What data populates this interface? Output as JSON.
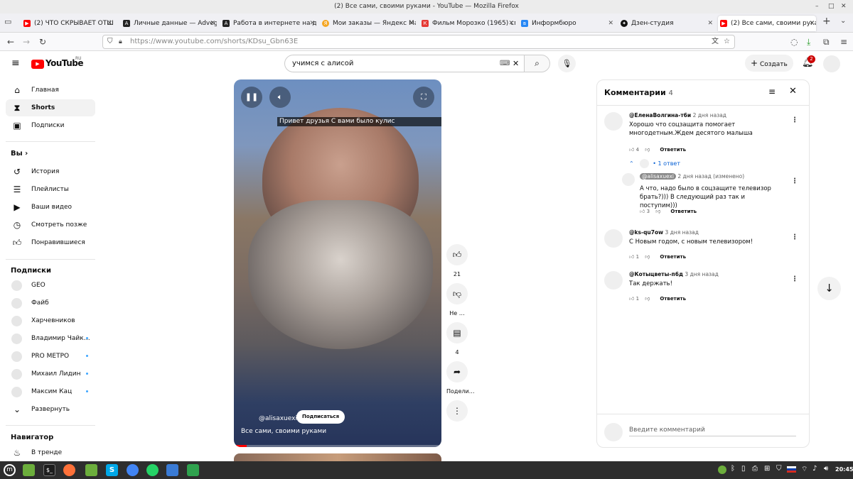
{
  "window": {
    "title": "(2) Все сами, своими руками - YouTube — Mozilla Firefox"
  },
  "tabs": [
    {
      "label": "(2) ЧТО СКРЫВАЕТ ОТШЕЛ",
      "fav": "yt"
    },
    {
      "label": "Личные данные — Advego",
      "fav": "A"
    },
    {
      "label": "Работа в интернете на до",
      "fav": "A"
    },
    {
      "label": "Мои заказы — Яндекс Ма",
      "fav": "Я"
    },
    {
      "label": "Фильм Морозко (1965) см",
      "fav": "К"
    },
    {
      "label": "Информбюро",
      "fav": "VK"
    },
    {
      "label": "Дзен-студия",
      "fav": "Д"
    },
    {
      "label": "(2) Все сами, своими рука",
      "fav": "yt"
    }
  ],
  "url": "https://www.youtube.com/shorts/KDsu_Gbn63E",
  "yt": {
    "logo": "YouTube",
    "region": "RU",
    "search_value": "учимся с алисой",
    "create_label": "Создать",
    "notif_count": "2"
  },
  "sidebar": {
    "main": [
      {
        "label": "Главная",
        "icon": "home-icon"
      },
      {
        "label": "Shorts",
        "icon": "shorts-icon"
      },
      {
        "label": "Подписки",
        "icon": "subscriptions-icon"
      }
    ],
    "you_header": "Вы",
    "you": [
      {
        "label": "История",
        "icon": "history-icon"
      },
      {
        "label": "Плейлисты",
        "icon": "playlists-icon"
      },
      {
        "label": "Ваши видео",
        "icon": "your-videos-icon"
      },
      {
        "label": "Смотреть позже",
        "icon": "watch-later-icon"
      },
      {
        "label": "Понравившиеся",
        "icon": "liked-icon"
      }
    ],
    "subs_header": "Подписки",
    "subs": [
      {
        "label": "GEO",
        "dot": false
      },
      {
        "label": "Файб",
        "dot": false
      },
      {
        "label": "Харчевников",
        "dot": false
      },
      {
        "label": "Владимир Чайк…",
        "dot": true
      },
      {
        "label": "PRO МЕТРО",
        "dot": true
      },
      {
        "label": "Михаил Лидин",
        "dot": true
      },
      {
        "label": "Максим Кац",
        "dot": true
      }
    ],
    "expand": "Развернуть",
    "nav_header": "Навигатор",
    "trending": "В тренде"
  },
  "video": {
    "caption": "Привет друзья С вами было кулис",
    "channel": "@alisaxuexi",
    "subscribe": "Подписаться",
    "title": "Все сами, своими руками",
    "progress": 0.06
  },
  "actions": {
    "likes": "21",
    "dislike": "Не …",
    "comments": "4",
    "share": "Подели…"
  },
  "comments": {
    "header": "Комментарии",
    "count": "4",
    "reply_label": "Ответить",
    "replies_toggle": "1 ответ",
    "items": [
      {
        "author": "@ЕленаВолгина-т6и",
        "time": "2 дня назад",
        "text": "Хорошо что соцзащита помогает многодетным.Ждем десятого малыша",
        "likes": "4"
      },
      {
        "author": "@alisaxuexi",
        "time": "2 дня назад (изменено)",
        "text": "А что, надо было в соцзащите телевизор брать?))) В следующий раз так и поступим)))",
        "likes": "3"
      },
      {
        "author": "@ks-qu7ow",
        "time": "3 дня назад",
        "text": "С Новым годом, с новым телевизором!",
        "likes": "1"
      },
      {
        "author": "@Котыцветы-п6д",
        "time": "3 дня назад",
        "text": "Так держать!",
        "likes": "1"
      }
    ],
    "input_placeholder": "Введите комментарий"
  },
  "taskbar": {
    "time": "20:45"
  }
}
